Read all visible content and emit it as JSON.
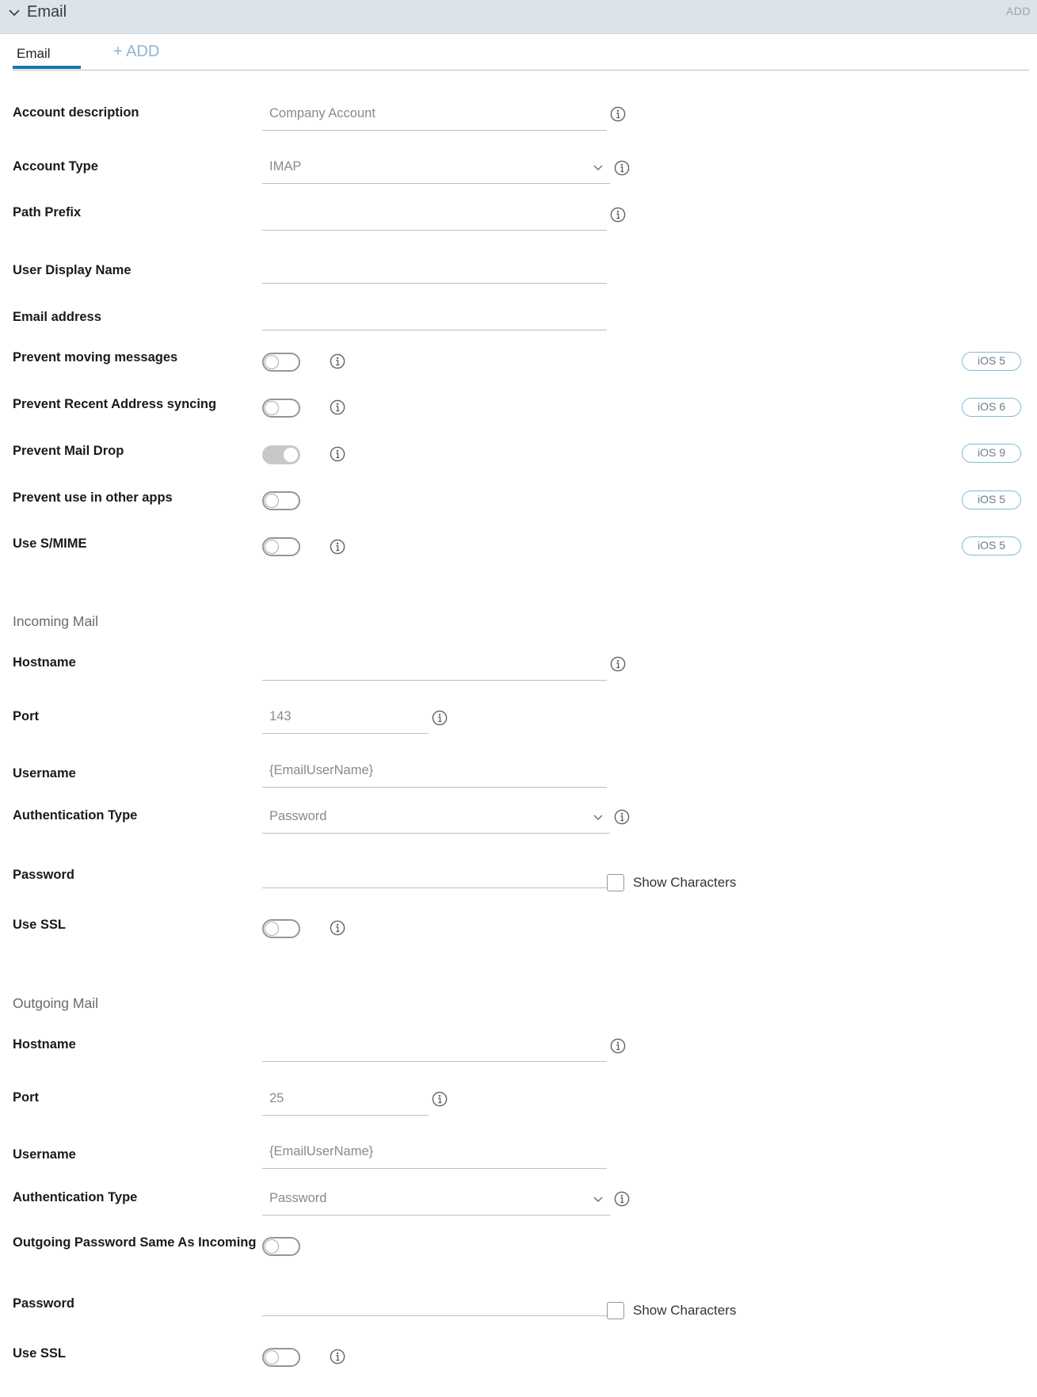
{
  "header": {
    "title": "Email",
    "add_label": "ADD"
  },
  "tabs": {
    "email_label": "Email",
    "add_label": "+ ADD"
  },
  "general": {
    "account_description": {
      "label": "Account description",
      "placeholder": "Company Account"
    },
    "account_type": {
      "label": "Account Type",
      "value": "IMAP"
    },
    "path_prefix": {
      "label": "Path Prefix",
      "value": ""
    },
    "user_display_name": {
      "label": "User Display Name",
      "value": ""
    },
    "email_address": {
      "label": "Email address",
      "value": ""
    },
    "toggles": [
      {
        "label": "Prevent moving messages",
        "on": false,
        "badge": "iOS 5"
      },
      {
        "label": "Prevent Recent Address syncing",
        "on": false,
        "badge": "iOS 6"
      },
      {
        "label": "Prevent Mail Drop",
        "on": true,
        "badge": "iOS 9"
      },
      {
        "label": "Prevent use in other apps",
        "on": false,
        "badge": "iOS 5"
      },
      {
        "label": "Use S/MIME",
        "on": false,
        "badge": "iOS 5"
      }
    ]
  },
  "incoming": {
    "section_title": "Incoming Mail",
    "hostname_label": "Hostname",
    "port_label": "Port",
    "port_placeholder": "143",
    "username_label": "Username",
    "username_placeholder": "{EmailUserName}",
    "auth_label": "Authentication Type",
    "auth_value": "Password",
    "password_label": "Password",
    "show_chars_label": "Show Characters",
    "ssl_label": "Use SSL"
  },
  "outgoing": {
    "section_title": "Outgoing Mail",
    "hostname_label": "Hostname",
    "port_label": "Port",
    "port_placeholder": "25",
    "username_label": "Username",
    "username_placeholder": "{EmailUserName}",
    "auth_label": "Authentication Type",
    "auth_value": "Password",
    "same_password_label": "Outgoing Password Same As Incoming",
    "password_label": "Password",
    "show_chars_label": "Show Characters",
    "ssl_label": "Use SSL"
  },
  "colors": {
    "accent": "#1f73a8",
    "badge_border": "#7fbcd6",
    "header_bg": "#dbe4ea"
  }
}
